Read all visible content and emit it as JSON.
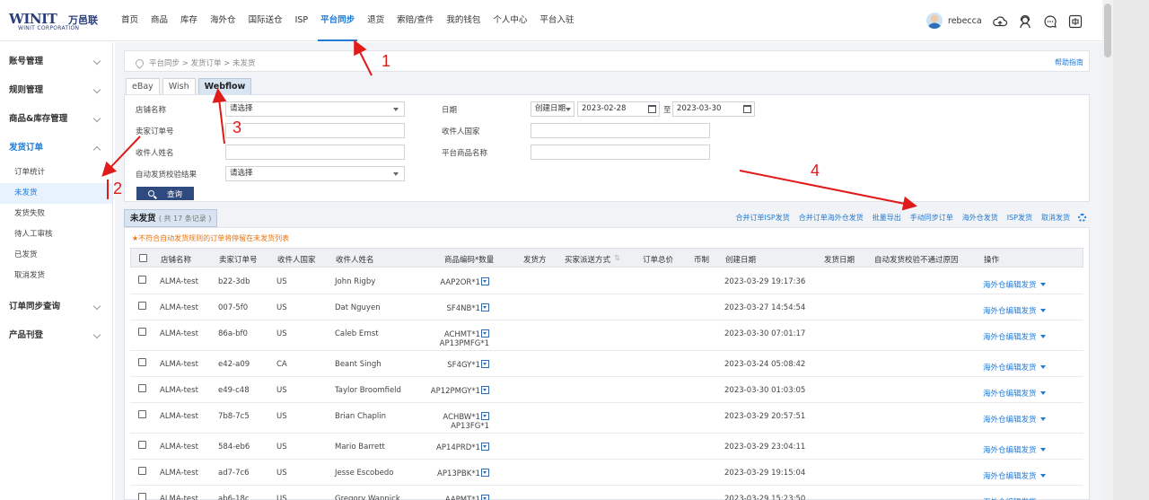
{
  "logo": {
    "main": "WINIT",
    "cn": "万邑联",
    "sub": "WINIT CORPORATION"
  },
  "nav": [
    "首页",
    "商品",
    "库存",
    "海外仓",
    "国际送仓",
    "ISP",
    "平台同步",
    "退货",
    "索赔/查件",
    "我的钱包",
    "个人中心",
    "平台入驻"
  ],
  "nav_active_index": 6,
  "user": {
    "name": "rebecca"
  },
  "sidebar": {
    "groups_top": [
      "账号管理",
      "规则管理",
      "商品&库存管理"
    ],
    "open_group": "发货订单",
    "sub_items": [
      "订单统计",
      "未发货",
      "发货失败",
      "待人工审核",
      "已发货",
      "取消发货"
    ],
    "active_sub_index": 1,
    "groups_bottom": [
      "订单同步查询",
      "产品刊登"
    ]
  },
  "breadcrumb": "平台同步 > 发货订单 > 未发货",
  "help": "帮助指南",
  "tabs": [
    "eBay",
    "Wish",
    "Webflow"
  ],
  "active_tab_index": 2,
  "filter": {
    "store_label": "店铺名称",
    "store_value": "请选择",
    "seller_order_label": "卖家订单号",
    "recipient_name_label": "收件人姓名",
    "auto_check_label": "自动发货校验结果",
    "auto_check_value": "请选择",
    "date_label": "日期",
    "date_type": "创建日期",
    "date_from": "2023-02-28",
    "date_to_sep": "至",
    "date_to": "2023-03-30",
    "country_label": "收件人国家",
    "platform_product_label": "平台商品名称",
    "search_button": "查询"
  },
  "list": {
    "title": "未发货",
    "count_text": "( 共 17 条记录 )",
    "actions": [
      "合并订单ISP发货",
      "合并订单海外仓发货",
      "批量导出",
      "手动同步订单",
      "海外仓发货",
      "ISP发货",
      "取消发货"
    ],
    "warning": "★不符合自动发货规则的订单将停留在未发货列表"
  },
  "table": {
    "headers": [
      "店铺名称",
      "卖家订单号",
      "收件人国家",
      "收件人姓名",
      "商品编码*数量",
      "发货方",
      "买家派送方式",
      "订单总价",
      "币制",
      "创建日期",
      "发货日期",
      "自动发货校验不通过原因",
      "操作"
    ],
    "op_label": "海外仓编辑发货",
    "rows": [
      {
        "store": "ALMA-test",
        "order": "b22-3db",
        "country": "US",
        "name": "John Rigby",
        "skus": [
          "AAP2OR*1"
        ],
        "created": "2023-03-29 19:17:36"
      },
      {
        "store": "ALMA-test",
        "order": "007-5f0",
        "country": "US",
        "name": "Dat Nguyen",
        "skus": [
          "SF4NB*1"
        ],
        "created": "2023-03-27 14:54:54"
      },
      {
        "store": "ALMA-test",
        "order": "86a-bf0",
        "country": "US",
        "name": "Caleb Ernst",
        "skus": [
          "ACHMT*1",
          "AP13PMFG*1"
        ],
        "created": "2023-03-30 07:01:17"
      },
      {
        "store": "ALMA-test",
        "order": "e42-a09",
        "country": "CA",
        "name": "Beant Singh",
        "skus": [
          "SF4GY*1"
        ],
        "created": "2023-03-24 05:08:42"
      },
      {
        "store": "ALMA-test",
        "order": "e49-c48",
        "country": "US",
        "name": "Taylor Broomfield",
        "skus": [
          "AP12PMGY*1"
        ],
        "created": "2023-03-30 01:03:05"
      },
      {
        "store": "ALMA-test",
        "order": "7b8-7c5",
        "country": "US",
        "name": "Brian Chaplin",
        "skus": [
          "ACHBW*1",
          "AP13FG*1"
        ],
        "created": "2023-03-29 20:57:51"
      },
      {
        "store": "ALMA-test",
        "order": "584-eb6",
        "country": "US",
        "name": "Mario Barrett",
        "skus": [
          "AP14PRD*1"
        ],
        "created": "2023-03-29 23:04:11"
      },
      {
        "store": "ALMA-test",
        "order": "ad7-7c6",
        "country": "US",
        "name": "Jesse Escobedo",
        "skus": [
          "AP13PBK*1"
        ],
        "created": "2023-03-29 19:15:04"
      },
      {
        "store": "ALMA-test",
        "order": "ab6-18c",
        "country": "US",
        "name": "Gregory Wannick",
        "skus": [
          "AAPMT*1"
        ],
        "created": "2023-03-29 15:23:50"
      }
    ]
  },
  "annotations": [
    "1",
    "2",
    "3",
    "4"
  ],
  "colors": {
    "accent": "#1f7ad6",
    "annotation": "#e01b1b",
    "warning": "#e8730c",
    "button": "#2e4a7e"
  }
}
